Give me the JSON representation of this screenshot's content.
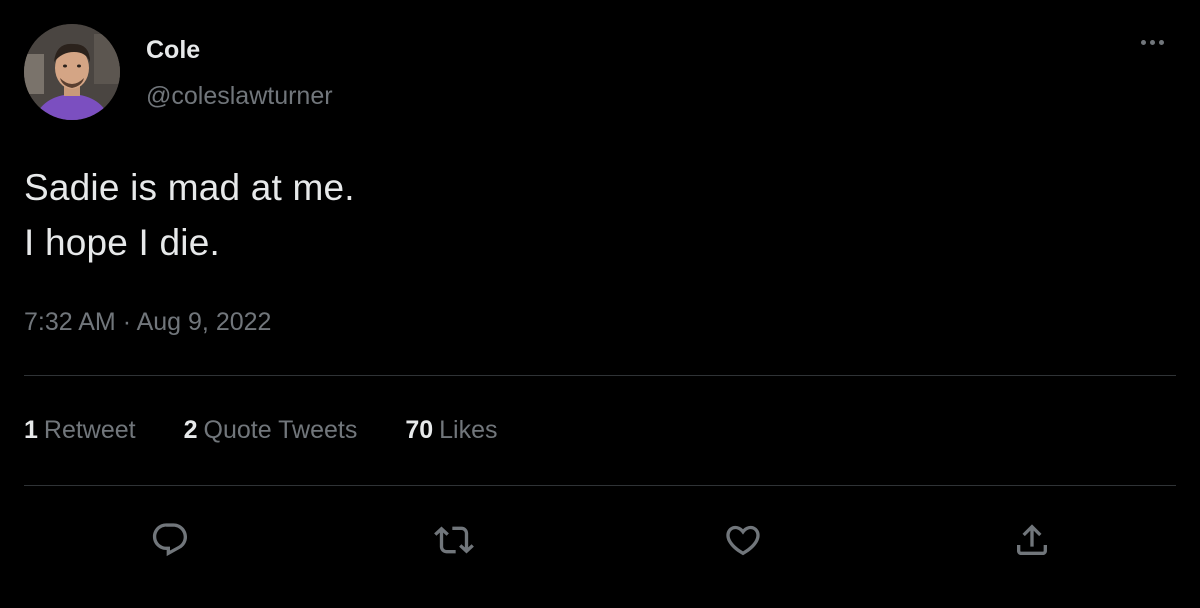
{
  "author": {
    "display_name": "Cole",
    "handle": "@coleslawturner"
  },
  "tweet": {
    "lines": [
      "Sadie is mad at me.",
      "I hope I die."
    ],
    "time": "7:32 AM",
    "separator": "·",
    "date": "Aug 9, 2022"
  },
  "stats": {
    "retweets": {
      "count": "1",
      "label": "Retweet"
    },
    "quotes": {
      "count": "2",
      "label": "Quote Tweets"
    },
    "likes": {
      "count": "70",
      "label": "Likes"
    }
  },
  "actions": {
    "reply_icon": "speech-bubble",
    "retweet_icon": "retweet-arrows",
    "like_icon": "heart",
    "share_icon": "upload-arrow"
  },
  "colors": {
    "background": "#000000",
    "text_primary": "#e7e9ea",
    "text_secondary": "#71767b",
    "divider": "#2f3336"
  }
}
